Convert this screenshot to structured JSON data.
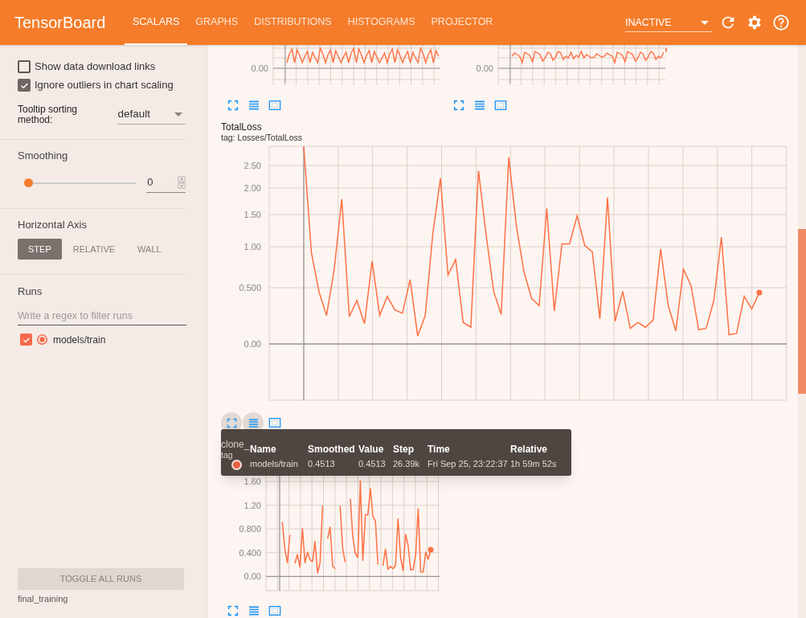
{
  "header": {
    "title": "TensorBoard",
    "tabs": [
      {
        "label": "SCALARS",
        "selected": true
      },
      {
        "label": "GRAPHS",
        "selected": false
      },
      {
        "label": "DISTRIBUTIONS",
        "selected": false
      },
      {
        "label": "HISTOGRAMS",
        "selected": false
      },
      {
        "label": "PROJECTOR",
        "selected": false
      }
    ],
    "run_selector": {
      "value": "INACTIVE"
    }
  },
  "sidebar": {
    "options": [
      {
        "label": "Show data download links",
        "checked": false
      },
      {
        "label": "Ignore outliers in chart scaling",
        "checked": true
      }
    ],
    "tooltip_sorting": {
      "label": "Tooltip sorting method:",
      "value": "default"
    },
    "smoothing": {
      "label": "Smoothing",
      "level": 0,
      "value": "0"
    },
    "horizontal_axis": {
      "label": "Horizontal Axis",
      "options": [
        {
          "label": "STEP",
          "selected": true
        },
        {
          "label": "RELATIVE",
          "selected": false
        },
        {
          "label": "WALL",
          "selected": false
        }
      ]
    },
    "runs": {
      "label": "Runs",
      "placeholder": "Write a regex to filter runs",
      "items": [
        {
          "name": "models/train",
          "checked": true,
          "color": "#f4694a"
        }
      ]
    },
    "toggle_button": "TOGGLE ALL RUNS",
    "footer": "final_training"
  },
  "top_charts": [
    {
      "tick": "0.00",
      "end_point": false
    },
    {
      "tick": "0.00",
      "end_point": true
    }
  ],
  "cards": [
    {
      "title": "TotalLoss",
      "tag": "tag: Losses/TotalLoss",
      "hovered": true,
      "y_labels": [
        "2.50",
        "2.00",
        "1.50",
        "1.00",
        "0.500",
        "0.00"
      ]
    },
    {
      "title": "clone_",
      "tag": "tag",
      "hovered": false,
      "chart_data": {
        "type": "line",
        "grid": true,
        "categories": [
          null,
          null,
          null,
          null,
          null,
          null,
          null,
          null,
          null,
          null,
          null,
          null,
          null,
          null,
          null,
          null,
          null,
          null,
          null,
          null,
          null,
          null,
          null,
          null,
          null,
          null,
          null,
          null,
          null,
          null,
          null,
          null,
          null,
          null,
          null,
          null,
          null,
          null,
          null,
          null,
          null,
          null,
          null,
          null,
          null,
          null,
          null,
          null,
          null,
          null,
          null,
          null,
          null,
          null,
          null,
          null,
          null,
          null,
          null,
          null,
          null,
          null,
          null,
          null,
          null,
          null,
          null,
          null,
          null
        ],
        "ylim": [
          -0.24,
          1.9
        ],
        "series": [
          {
            "color": "#ff7043",
            "values": [
              null,
              null,
              null,
              null,
              null,
              null,
              0.92,
              0.46,
              0.23,
              0.7,
              null,
              0.22,
              0.37,
              0.16,
              0.81,
              0.23,
              0.41,
              0.28,
              0.25,
              0.59,
              0.06,
              0.23,
              1.19,
              null,
              0.64,
              0.83,
              0.17,
              0.13,
              null,
              1.19,
              0.46,
              0.24,
              null,
              1.31,
              0.68,
              0.39,
              0.32,
              1.61,
              0.27,
              1.04,
              1.04,
              1.48,
              1.02,
              0.93,
              0.2,
              null,
              0.18,
              0.46,
              0.12,
              0.17,
              0.13,
              0.19,
              0.97,
              0.32,
              0.1,
              0.71,
              0.52,
              0.11,
              0.12,
              0.37,
              1.14,
              0.07,
              0.08,
              0.41,
              0.29,
              0.45,
              null,
              null,
              null
            ]
          }
        ],
        "yticks": [
          {
            "value": 0,
            "label": "0.00"
          },
          {
            "value": 0.4,
            "label": "0.400"
          },
          {
            "value": 0.8,
            "label": "0.800"
          },
          {
            "value": 1.2,
            "label": "1.20"
          },
          {
            "value": 1.6,
            "label": "1.60"
          }
        ]
      }
    }
  ],
  "tooltip": {
    "columns": [
      "Name",
      "Smoothed",
      "Value",
      "Step",
      "Time",
      "Relative"
    ],
    "rows": [
      {
        "color": "#e5603f",
        "cells": [
          "models/train",
          "0.4513",
          "0.4513",
          "26.39k",
          "Fri Sep 25, 23:22:37",
          "1h 59m 52s"
        ]
      }
    ]
  }
}
